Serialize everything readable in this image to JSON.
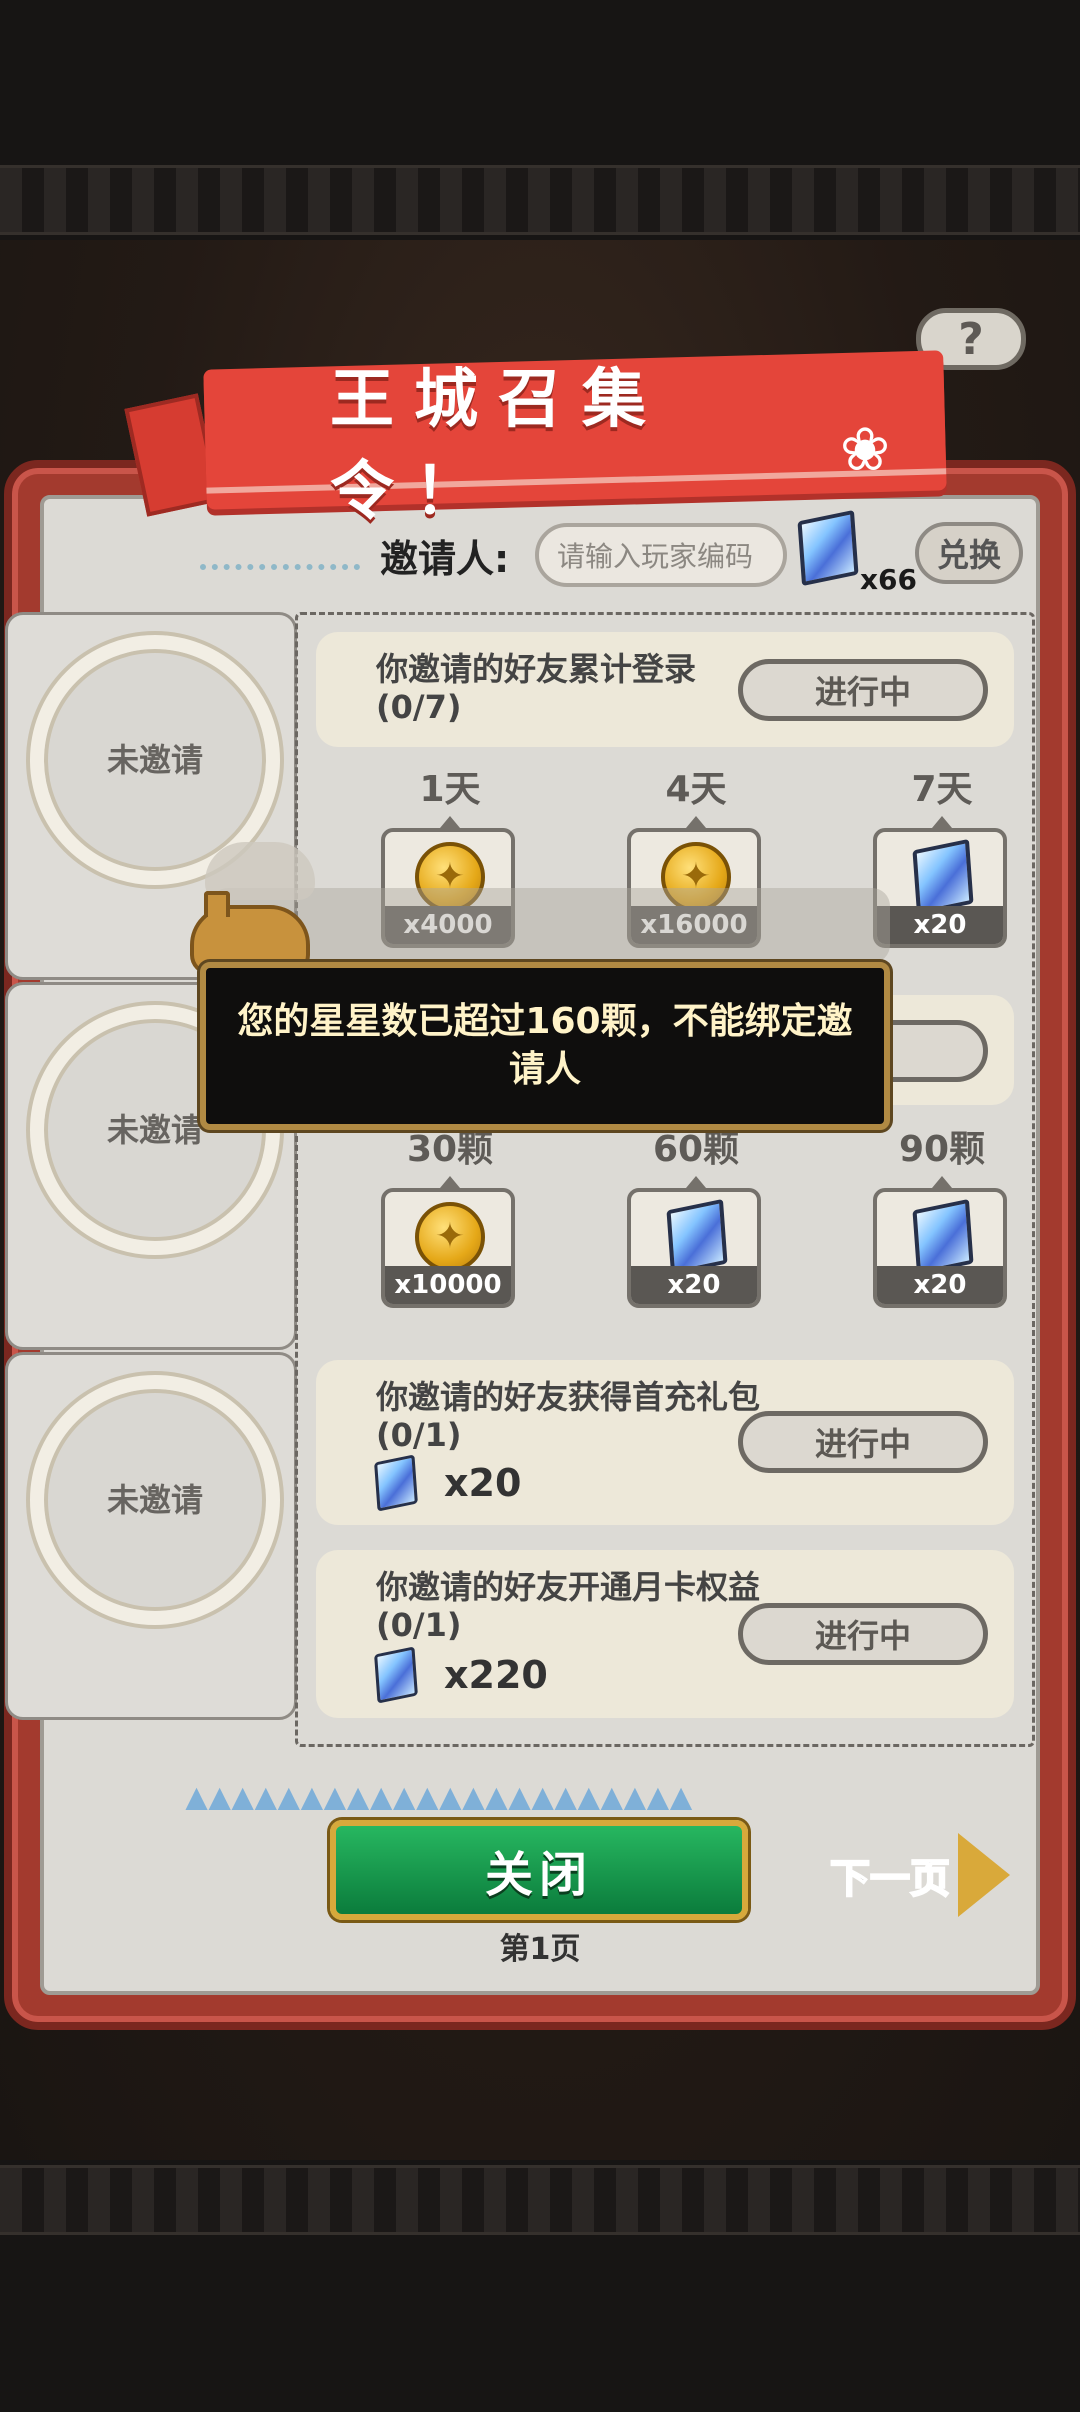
{
  "header": {
    "title": "王城召集令！",
    "help_label": "?"
  },
  "inviter": {
    "label": "邀请人:",
    "placeholder": "请输入玩家编码",
    "gem_count": "x66",
    "redeem_label": "兑换"
  },
  "slots": [
    {
      "label": "未邀请"
    },
    {
      "label": "未邀请"
    },
    {
      "label": "未邀请"
    }
  ],
  "tasks": {
    "login": {
      "title": "你邀请的好友累计登录(0/7)",
      "status": "进行中",
      "milestones": [
        {
          "day": "1天",
          "reward": "coin",
          "qty": "x4000"
        },
        {
          "day": "4天",
          "reward": "coin",
          "qty": "x16000"
        },
        {
          "day": "7天",
          "reward": "gem",
          "qty": "x20"
        }
      ]
    },
    "stars": {
      "milestones": [
        {
          "day": "30颗",
          "reward": "coin",
          "qty": "x10000"
        },
        {
          "day": "60颗",
          "reward": "gem",
          "qty": "x20"
        },
        {
          "day": "90颗",
          "reward": "gem",
          "qty": "x20"
        }
      ]
    },
    "first_charge": {
      "title": "你邀请的好友获得首充礼包(0/1)",
      "status": "进行中",
      "reward_qty": "x20"
    },
    "month_card": {
      "title": "你邀请的好友开通月卡权益(0/1)",
      "status": "进行中",
      "reward_qty": "x220"
    }
  },
  "footer": {
    "close_label": "关闭",
    "page_label": "第1页",
    "next_label": "下一页"
  },
  "toast": {
    "message": "您的星星数已超过160颗，不能绑定邀请人"
  },
  "icons": [
    "help-icon",
    "gem-icon",
    "coin-icon",
    "next-arrow-icon",
    "dog-mascot-icon"
  ],
  "colors": {
    "accent_red": "#e4453a",
    "button_green": "#0b7c3c",
    "gold": "#d7a93b"
  }
}
